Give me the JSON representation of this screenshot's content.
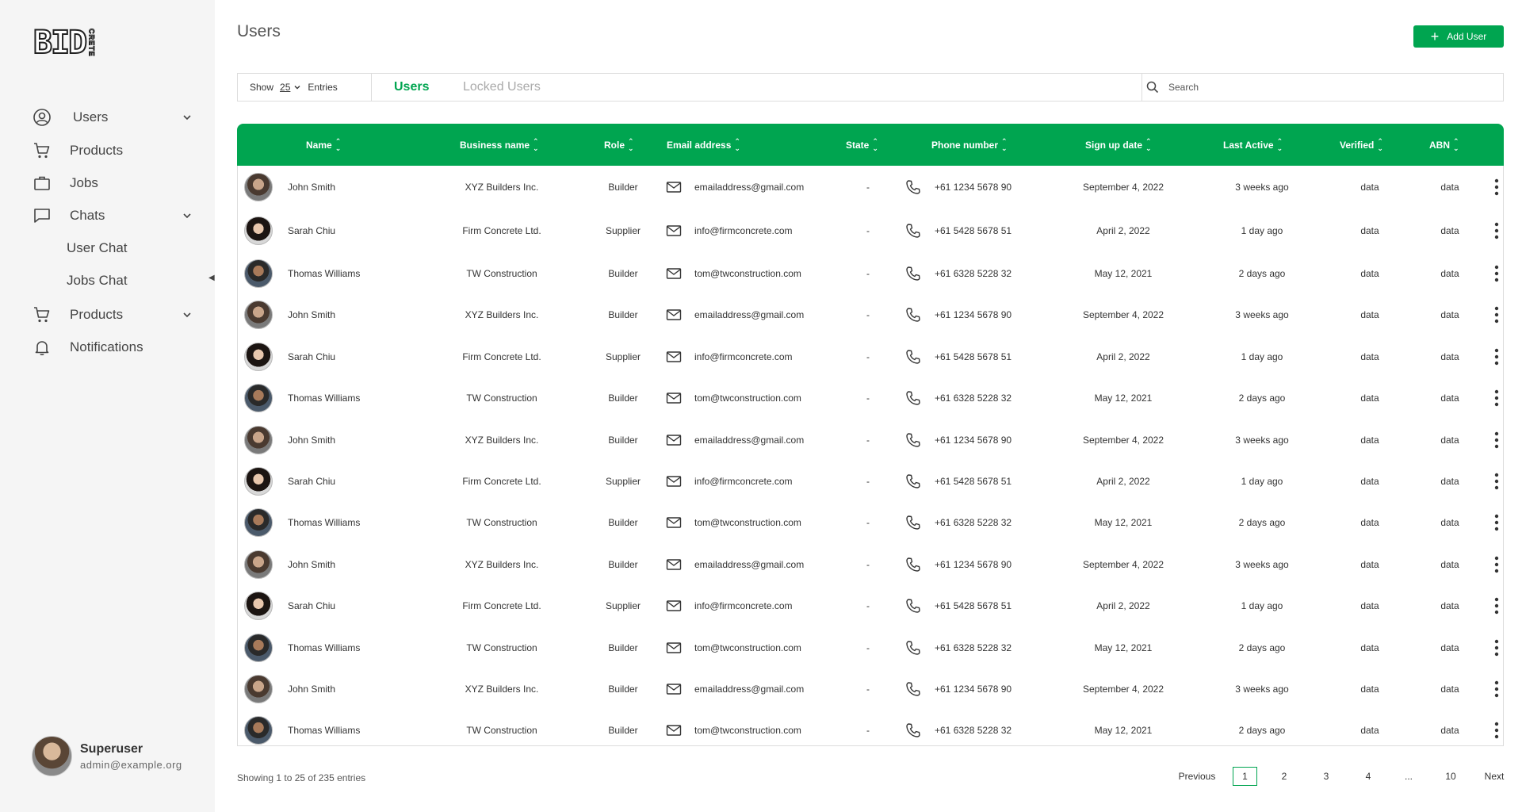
{
  "brand": {
    "logo_text": "BID",
    "logo_vertical": "CRETE"
  },
  "sidebar": {
    "nav": [
      {
        "label": "Users",
        "icon": "user-circle-icon",
        "chevron": true
      },
      {
        "label": "Products",
        "icon": "cart-icon",
        "chevron": false
      },
      {
        "label": "Jobs",
        "icon": "briefcase-icon",
        "chevron": false
      },
      {
        "label": "Chats",
        "icon": "chat-icon",
        "chevron": true
      },
      {
        "label": "User Chat",
        "sub": true
      },
      {
        "label": "Jobs Chat",
        "sub": true
      },
      {
        "label": "Products",
        "icon": "cart-icon",
        "chevron": true
      },
      {
        "label": "Notifications",
        "icon": "bell-icon",
        "chevron": false
      }
    ],
    "profile": {
      "name": "Superuser",
      "email": "admin@example.org"
    }
  },
  "page": {
    "title": "Users",
    "add_button": "Add User"
  },
  "toolbar": {
    "show_label": "Show",
    "entries_value": "25",
    "entries_label": "Entries",
    "tabs": [
      "Users",
      "Locked Users"
    ],
    "search_placeholder": "Search"
  },
  "table": {
    "columns": [
      "Name",
      "Business name",
      "Role",
      "Email address",
      "State",
      "Phone number",
      "Sign up date",
      "Last Active",
      "Verified",
      "ABN"
    ],
    "rows": [
      {
        "avatar": "john",
        "name": "John Smith",
        "business": "XYZ Builders Inc.",
        "role": "Builder",
        "email": "emailaddress@gmail.com",
        "state": "-",
        "phone": "+61 1234 5678 90",
        "signup": "September 4, 2022",
        "last_active": "3 weeks ago",
        "verified": "data",
        "abn": "data"
      },
      {
        "avatar": "sarah",
        "name": "Sarah Chiu",
        "business": "Firm Concrete Ltd.",
        "role": "Supplier",
        "email": "info@firmconcrete.com",
        "state": "-",
        "phone": "+61 5428 5678 51",
        "signup": "April 2, 2022",
        "last_active": "1 day ago",
        "verified": "data",
        "abn": "data"
      },
      {
        "avatar": "thomas",
        "name": "Thomas Williams",
        "business": "TW Construction",
        "role": "Builder",
        "email": "tom@twconstruction.com",
        "state": "-",
        "phone": "+61 6328 5228 32",
        "signup": "May 12, 2021",
        "last_active": "2 days ago",
        "verified": "data",
        "abn": "data"
      },
      {
        "avatar": "john",
        "name": "John Smith",
        "business": "XYZ Builders Inc.",
        "role": "Builder",
        "email": "emailaddress@gmail.com",
        "state": "-",
        "phone": "+61 1234 5678 90",
        "signup": "September 4, 2022",
        "last_active": "3 weeks ago",
        "verified": "data",
        "abn": "data"
      },
      {
        "avatar": "sarah",
        "name": "Sarah Chiu",
        "business": "Firm Concrete Ltd.",
        "role": "Supplier",
        "email": "info@firmconcrete.com",
        "state": "-",
        "phone": "+61 5428 5678 51",
        "signup": "April 2, 2022",
        "last_active": "1 day ago",
        "verified": "data",
        "abn": "data"
      },
      {
        "avatar": "thomas",
        "name": "Thomas Williams",
        "business": "TW Construction",
        "role": "Builder",
        "email": "tom@twconstruction.com",
        "state": "-",
        "phone": "+61 6328 5228 32",
        "signup": "May 12, 2021",
        "last_active": "2 days ago",
        "verified": "data",
        "abn": "data"
      },
      {
        "avatar": "john",
        "name": "John Smith",
        "business": "XYZ Builders Inc.",
        "role": "Builder",
        "email": "emailaddress@gmail.com",
        "state": "-",
        "phone": "+61 1234 5678 90",
        "signup": "September 4, 2022",
        "last_active": "3 weeks ago",
        "verified": "data",
        "abn": "data"
      },
      {
        "avatar": "sarah",
        "name": "Sarah Chiu",
        "business": "Firm Concrete Ltd.",
        "role": "Supplier",
        "email": "info@firmconcrete.com",
        "state": "-",
        "phone": "+61 5428 5678 51",
        "signup": "April 2, 2022",
        "last_active": "1 day ago",
        "verified": "data",
        "abn": "data"
      },
      {
        "avatar": "thomas",
        "name": "Thomas Williams",
        "business": "TW Construction",
        "role": "Builder",
        "email": "tom@twconstruction.com",
        "state": "-",
        "phone": "+61 6328 5228 32",
        "signup": "May 12, 2021",
        "last_active": "2 days ago",
        "verified": "data",
        "abn": "data"
      },
      {
        "avatar": "john",
        "name": "John Smith",
        "business": "XYZ Builders Inc.",
        "role": "Builder",
        "email": "emailaddress@gmail.com",
        "state": "-",
        "phone": "+61 1234 5678 90",
        "signup": "September 4, 2022",
        "last_active": "3 weeks ago",
        "verified": "data",
        "abn": "data"
      },
      {
        "avatar": "sarah",
        "name": "Sarah Chiu",
        "business": "Firm Concrete Ltd.",
        "role": "Supplier",
        "email": "info@firmconcrete.com",
        "state": "-",
        "phone": "+61 5428 5678 51",
        "signup": "April 2, 2022",
        "last_active": "1 day ago",
        "verified": "data",
        "abn": "data"
      },
      {
        "avatar": "thomas",
        "name": "Thomas Williams",
        "business": "TW Construction",
        "role": "Builder",
        "email": "tom@twconstruction.com",
        "state": "-",
        "phone": "+61 6328 5228 32",
        "signup": "May 12, 2021",
        "last_active": "2 days ago",
        "verified": "data",
        "abn": "data"
      },
      {
        "avatar": "john",
        "name": "John Smith",
        "business": "XYZ Builders Inc.",
        "role": "Builder",
        "email": "emailaddress@gmail.com",
        "state": "-",
        "phone": "+61 1234 5678 90",
        "signup": "September 4, 2022",
        "last_active": "3 weeks ago",
        "verified": "data",
        "abn": "data"
      },
      {
        "avatar": "thomas",
        "name": "Thomas Williams",
        "business": "TW Construction",
        "role": "Builder",
        "email": "tom@twconstruction.com",
        "state": "-",
        "phone": "+61 6328 5228 32",
        "signup": "May 12, 2021",
        "last_active": "2 days ago",
        "verified": "data",
        "abn": "data"
      }
    ]
  },
  "footer": {
    "showing": "Showing 1 to 25 of 235 entries",
    "previous": "Previous",
    "pages": [
      "1",
      "2",
      "3",
      "4",
      "...",
      "10"
    ],
    "current_page": "1",
    "next": "Next"
  },
  "colors": {
    "accent": "#00a550",
    "sidebar_bg": "#f5f5f5"
  }
}
